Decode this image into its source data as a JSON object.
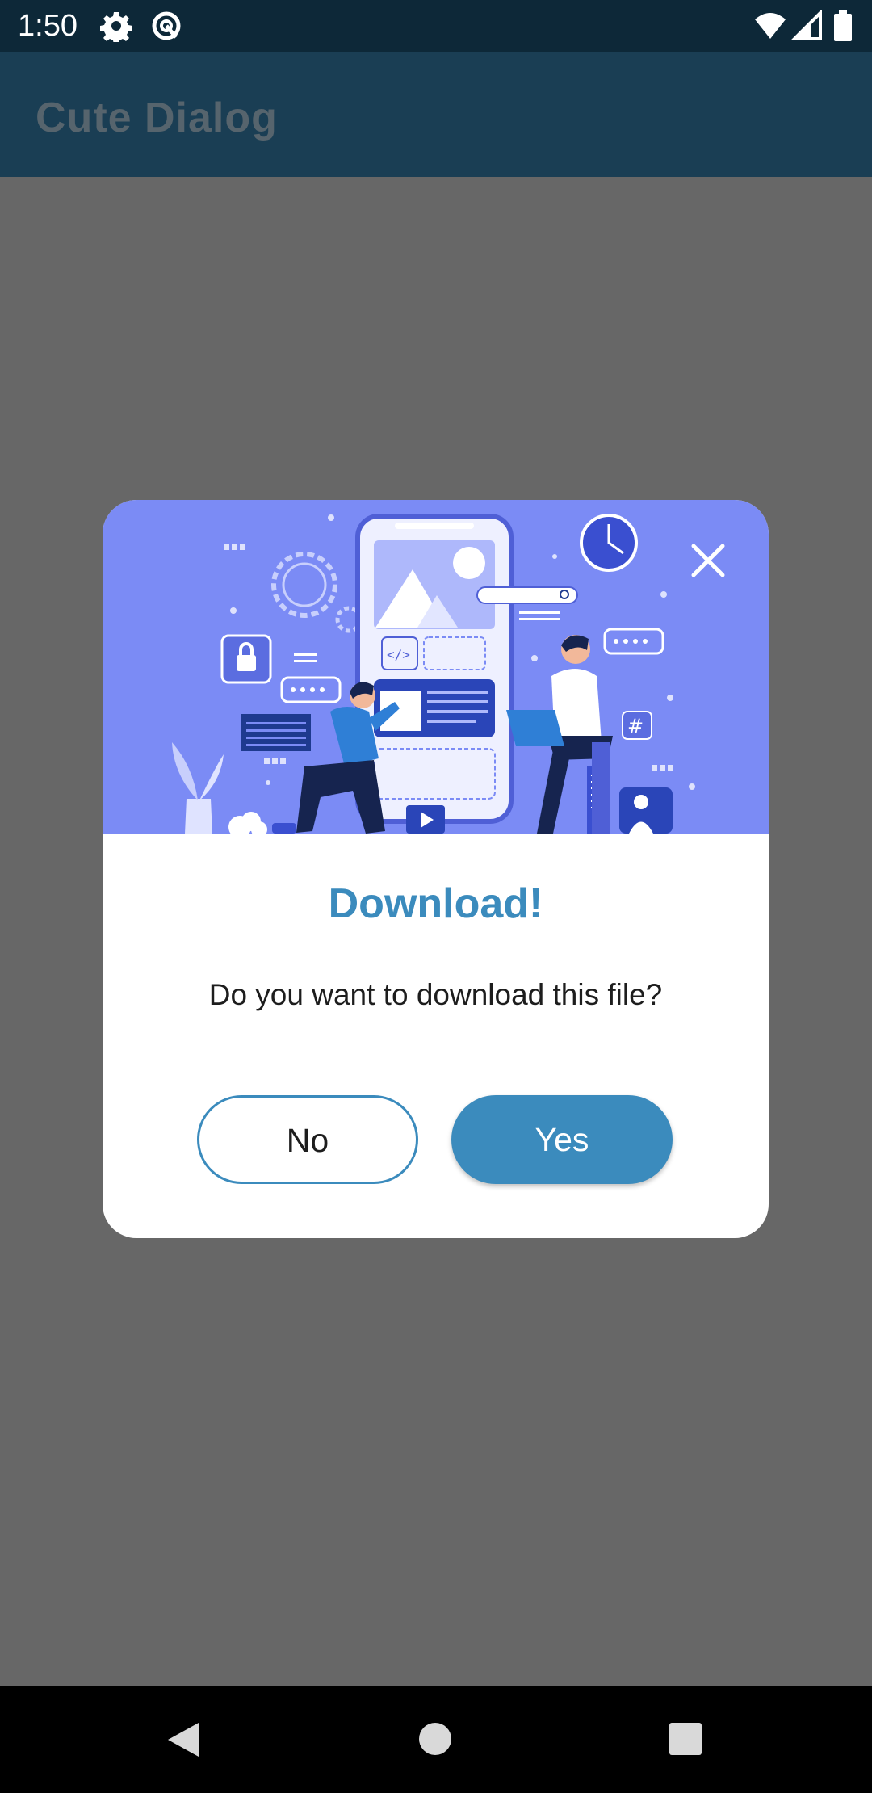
{
  "status_bar": {
    "time": "1:50",
    "left_icons": [
      "settings-gear-icon",
      "data-saver-icon"
    ],
    "right_icons": [
      "wifi-icon",
      "cell-signal-icon",
      "battery-icon"
    ]
  },
  "app_bar": {
    "title": "Cute Dialog"
  },
  "dialog": {
    "illustration": "app-development-illustration",
    "close_icon": "close-icon",
    "title": "Download!",
    "message": "Do you want to download this file?",
    "no_label": "No",
    "yes_label": "Yes"
  },
  "nav_bar": {
    "icons": [
      "back-icon",
      "home-icon",
      "recents-icon"
    ]
  },
  "colors": {
    "status_bar": "#0d2838",
    "app_bar": "#1a3e54",
    "scrim": "#676767",
    "banner": "#7b8bf5",
    "accent": "#3b8bbd"
  }
}
